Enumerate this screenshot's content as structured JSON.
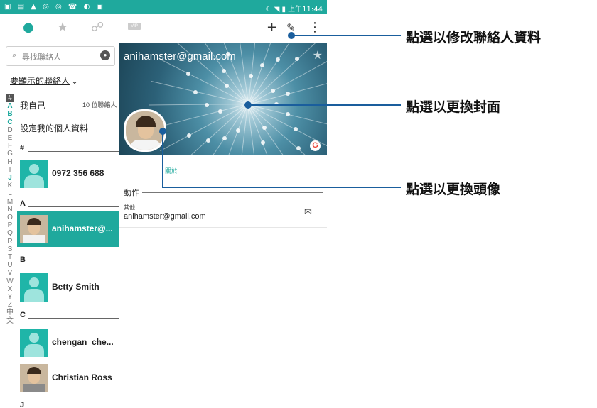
{
  "status_bar": {
    "time": "上午11:44"
  },
  "left_pane": {
    "search_placeholder": "尋找聯絡人",
    "filter_label": "要顯示的聯絡人",
    "me_label": "我自己",
    "contact_count": "10 位聯絡人",
    "profile_label": "設定我的個人資料",
    "alphabet": [
      "#",
      "A",
      "B",
      "C",
      "D",
      "E",
      "F",
      "G",
      "H",
      "I",
      "J",
      "K",
      "L",
      "M",
      "N",
      "O",
      "P",
      "Q",
      "R",
      "S",
      "T",
      "U",
      "V",
      "W",
      "X",
      "Y",
      "Z",
      "中",
      "文"
    ],
    "sections": {
      "hash": "#",
      "a": "A",
      "b": "B",
      "c": "C",
      "j": "J"
    },
    "contacts": [
      {
        "name": "0972 356 688"
      },
      {
        "name": "anihamster@..."
      },
      {
        "name": "Betty Smith"
      },
      {
        "name": "chengan_che..."
      },
      {
        "name": "Christian Ross"
      }
    ]
  },
  "right_pane": {
    "vip_label": "VIP",
    "cover_email": "anihamster@gmail.com",
    "google_badge": "G",
    "tab_about": "關於",
    "actions_label": "動作",
    "email_type": "其他",
    "email_value": "anihamster@gmail.com"
  },
  "annotations": {
    "edit_contact": "點選以修改聯絡人資料",
    "change_cover": "點選以更換封面",
    "change_avatar": "點選以更換頭像"
  },
  "colors": {
    "accent": "#1fa99d",
    "callout": "#1a5e9d"
  }
}
